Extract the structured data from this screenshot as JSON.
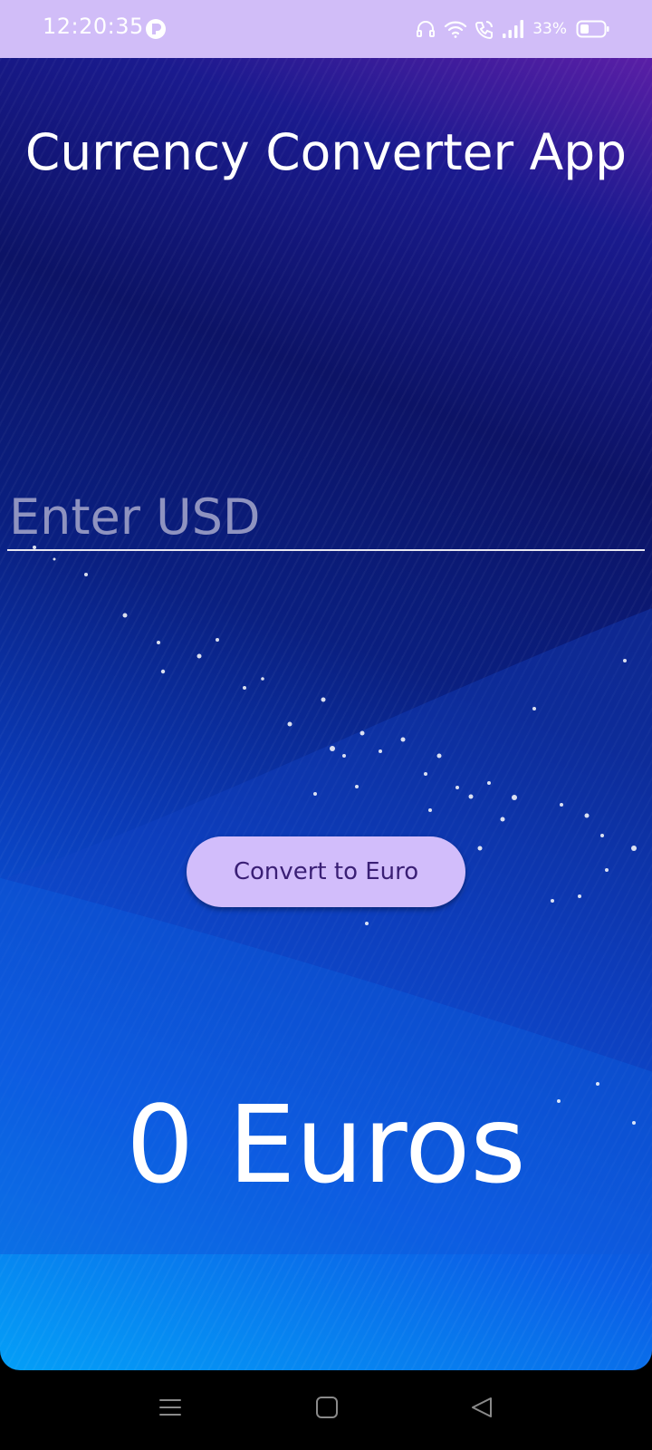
{
  "status_bar": {
    "time": "12:20:35",
    "battery_percent": "33%",
    "icons": [
      "app-notification-icon",
      "headset-icon",
      "wifi-icon",
      "wifi-calling-icon",
      "signal-icon",
      "battery-icon"
    ]
  },
  "app": {
    "title": "Currency Converter App",
    "usd_input": {
      "placeholder": "Enter USD",
      "value": ""
    },
    "convert_button_label": "Convert to Euro",
    "result_text": "0 Euros"
  },
  "nav_bar": {
    "icons": [
      "menu-icon",
      "home-icon",
      "back-icon"
    ]
  },
  "colors": {
    "status_bar_bg": "#d1bdf8",
    "button_bg": "#d2bdfb",
    "button_text": "#3a1f75",
    "background_top": "#0c1366",
    "background_bottom": "#049ff7"
  }
}
